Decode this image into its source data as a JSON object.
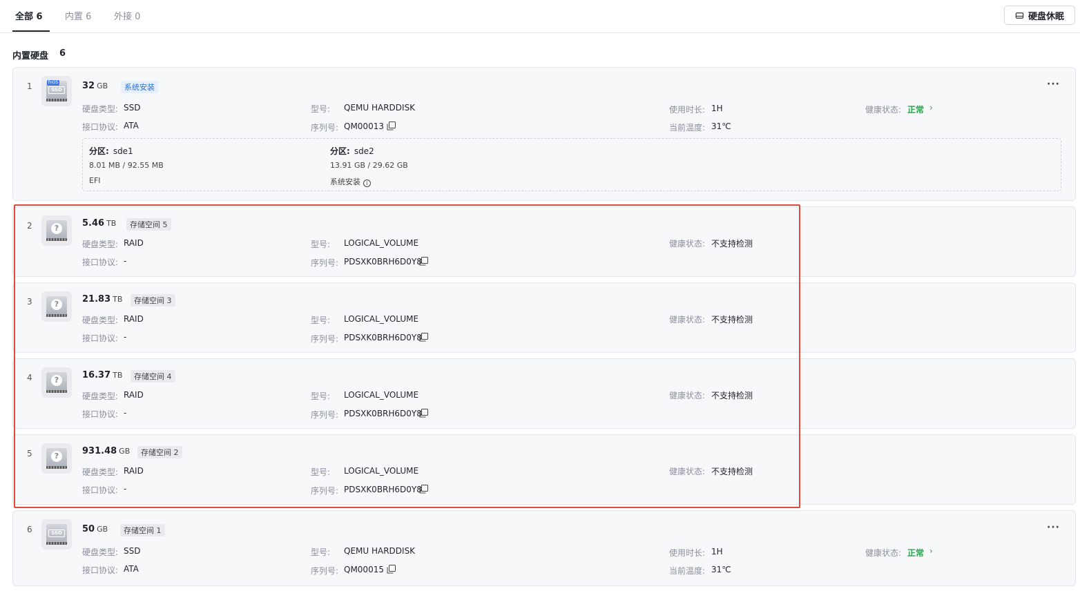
{
  "tabs": [
    {
      "label": "全部 6"
    },
    {
      "label": "内置 6"
    },
    {
      "label": "外接 0"
    }
  ],
  "sleep_button": {
    "label": "硬盘休眠",
    "icon": "disk-sleep-icon"
  },
  "section": {
    "title": "内置硬盘",
    "count": "6"
  },
  "labels": {
    "disk_type": "硬盘类型:",
    "model": "型号:",
    "protocol": "接口协议:",
    "serial": "序列号:",
    "usage": "使用时长:",
    "temp": "当前温度:",
    "health": "健康状态:",
    "partition": "分区:"
  },
  "disks": [
    {
      "index": "1",
      "capacity": "32",
      "unit": "GB",
      "badge": "系统安装",
      "icon": "ssd-icon",
      "type": "SSD",
      "model": "QEMU HARDDISK",
      "protocol": "ATA",
      "serial": "QM00013",
      "usage": "1H",
      "temp": "31℃",
      "health": "正常",
      "partitions": [
        {
          "name": "sde1",
          "size": "8.01 MB / 92.55 MB",
          "note": "EFI"
        },
        {
          "name": "sde2",
          "size": "13.91 GB / 29.62 GB",
          "note": "系统安装"
        }
      ]
    },
    {
      "index": "2",
      "capacity": "5.46",
      "unit": "TB",
      "badge": "存储空间 5",
      "type": "RAID",
      "model": "LOGICAL_VOLUME",
      "protocol": "-",
      "serial": "PDSXK0BRH6D0Y8",
      "health": "不支持检测"
    },
    {
      "index": "3",
      "capacity": "21.83",
      "unit": "TB",
      "badge": "存储空间 3",
      "type": "RAID",
      "model": "LOGICAL_VOLUME",
      "protocol": "-",
      "serial": "PDSXK0BRH6D0Y8",
      "health": "不支持检测"
    },
    {
      "index": "4",
      "capacity": "16.37",
      "unit": "TB",
      "badge": "存储空间 4",
      "type": "RAID",
      "model": "LOGICAL_VOLUME",
      "protocol": "-",
      "serial": "PDSXK0BRH6D0Y8",
      "health": "不支持检测"
    },
    {
      "index": "5",
      "capacity": "931.48",
      "unit": "GB",
      "badge": "存储空间 2",
      "type": "RAID",
      "model": "LOGICAL_VOLUME",
      "protocol": "-",
      "serial": "PDSXK0BRH6D0Y8",
      "health": "不支持检测"
    },
    {
      "index": "6",
      "capacity": "50",
      "unit": "GB",
      "badge": "存储空间 1",
      "icon": "ssd-icon",
      "type": "SSD",
      "model": "QEMU HARDDISK",
      "protocol": "ATA",
      "serial": "QM00015",
      "usage": "1H",
      "temp": "31℃",
      "health": "正常"
    }
  ],
  "colors": {
    "accent_green": "#2ea04f",
    "highlight_red": "#e04a3a",
    "badge_blue": "#2a6fd8"
  }
}
